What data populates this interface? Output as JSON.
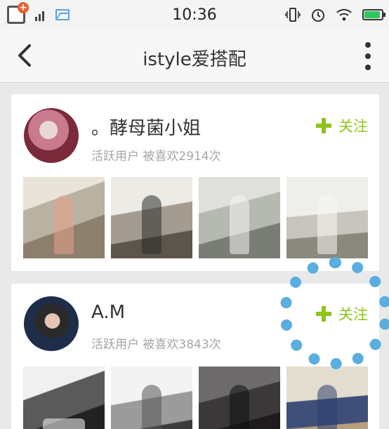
{
  "status_bar": {
    "time": "10:36",
    "icons": [
      "app-notification-icon",
      "signal-icon",
      "image-icon",
      "vibrate-icon",
      "alarm-icon",
      "wifi-icon",
      "battery-icon"
    ],
    "battery_level": 0.9,
    "accent": "#2ec95c"
  },
  "nav": {
    "title": "istyle爱搭配",
    "back_icon": "back-arrow-icon",
    "more_icon": "more-vertical-icon"
  },
  "feed": [
    {
      "name": "。酵母菌小姐",
      "status": "活跃用户",
      "likes": "被喜欢2914次",
      "follow_label": "关注",
      "photo_count": 4
    },
    {
      "name": "A.M",
      "status": "活跃用户",
      "likes": "被喜欢3843次",
      "follow_label": "关注",
      "photo_count": 4
    }
  ],
  "colors": {
    "follow_green": "#8fc31f",
    "highlight_ring": "#5aaee0"
  }
}
